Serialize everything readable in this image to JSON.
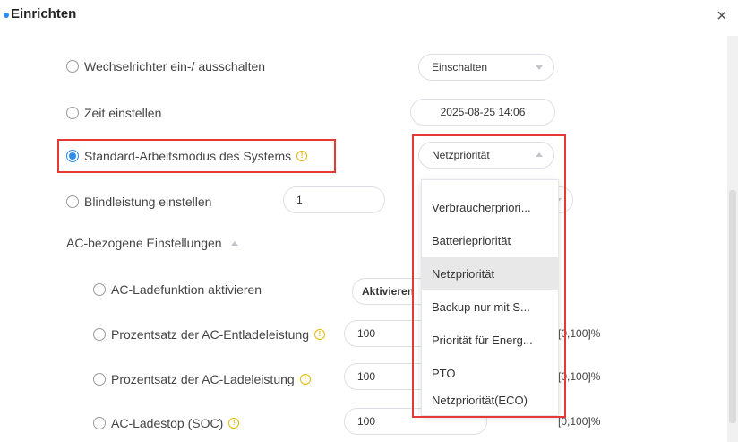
{
  "dialog": {
    "title": "Einrichten",
    "close_label": "×"
  },
  "rows": {
    "inverter": {
      "label": "Wechselrichter ein-/ ausschalten",
      "value": "Einschalten"
    },
    "time": {
      "label": "Zeit einstellen",
      "value": "2025-08-25 14:06"
    },
    "mode": {
      "label": "Standard-Arbeitsmodus des Systems",
      "value": "Netzpriorität"
    },
    "reactive": {
      "label": "Blindleistung einstellen",
      "value": "1"
    }
  },
  "ac_section": {
    "title": "AC-bezogene Einstellungen",
    "charge_enable": {
      "label": "AC-Ladefunktion aktivieren",
      "value": "Aktivieren"
    },
    "discharge_pct": {
      "label": "Prozentsatz der AC-Entladeleistung",
      "value": "100",
      "unit": "[0,100]%"
    },
    "charge_pct": {
      "label": "Prozentsatz der AC-Ladeleistung",
      "value": "100",
      "unit": "[0,100]%"
    },
    "charge_stop": {
      "label": "AC-Ladestop (SOC)",
      "value": "100",
      "unit": "[0,100]%"
    }
  },
  "dropdown": {
    "options": [
      "Verbraucherpriori...",
      "Batteriepriorität",
      "Netzpriorität",
      "Backup nur mit S...",
      "Priorität für Energ...",
      "PTO",
      "Netzpriorität(ECO)"
    ],
    "selected_index": 2
  },
  "colors": {
    "accent": "#2d8cf0",
    "highlight": "#e53935",
    "info": "#e6b800"
  }
}
